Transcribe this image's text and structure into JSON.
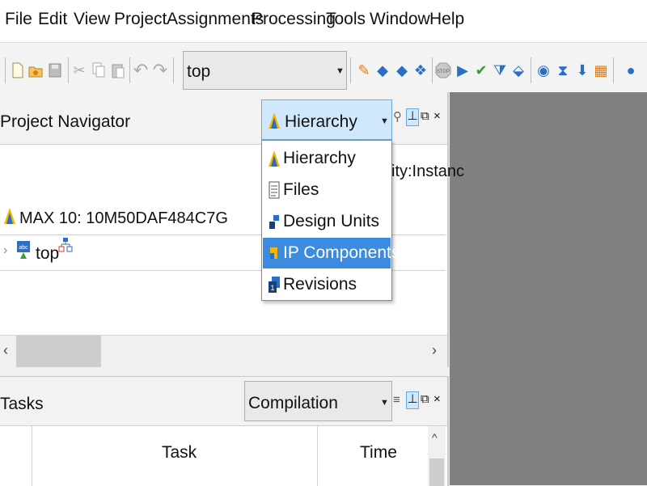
{
  "menubar": {
    "items": [
      "File",
      "Edit",
      "View",
      "Project",
      "Assignments",
      "Processing",
      "Tools",
      "Window",
      "Help"
    ]
  },
  "toolbar": {
    "entity_value": "top"
  },
  "project_navigator": {
    "title": "Project Navigator",
    "view_selected": "Hierarchy",
    "device": "MAX 10: 10M50DAF484C7G",
    "entity_column": "ity:Instanc",
    "top_entity": "top",
    "dropdown_items": [
      "Hierarchy",
      "Files",
      "Design Units",
      "IP Components",
      "Revisions"
    ],
    "highlighted_item": "IP Components"
  },
  "tasks": {
    "title": "Tasks",
    "flow_value": "Compilation",
    "columns": [
      "Task",
      "Time"
    ]
  },
  "colors": {
    "selection": "#3b8be0",
    "combo_focus": "#cfe8fb",
    "background_grey": "#808080"
  }
}
